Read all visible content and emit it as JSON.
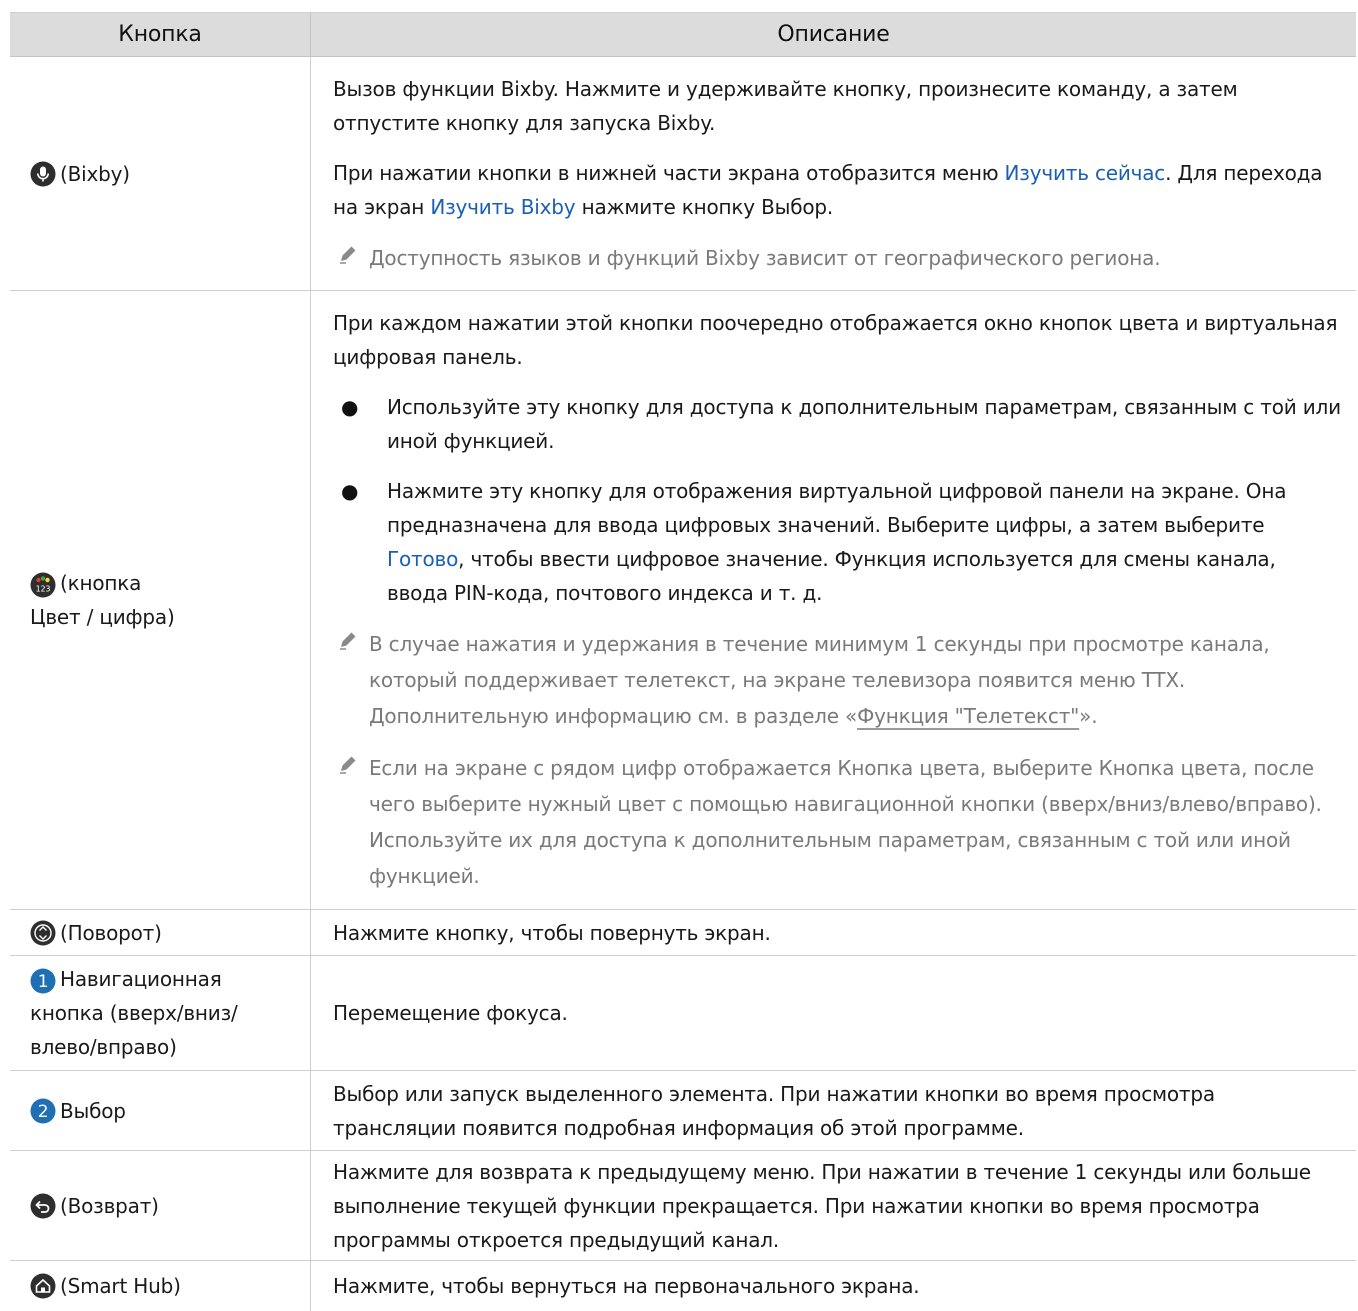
{
  "header": {
    "col_button": "Кнопка",
    "col_description": "Описание"
  },
  "rows": {
    "bixby": {
      "label": "(Bixby)",
      "p1": "Вызов функции Bixby. Нажмите и удерживайте кнопку, произнесите команду, а затем отпустите кнопку для запуска Bixby.",
      "p2_a": "При нажатии кнопки в нижней части экрана отобразится меню ",
      "p2_link1": "Изучить сейчас",
      "p2_b": ". Для перехода на экран ",
      "p2_link2": "Изучить Bixby",
      "p2_c": " нажмите кнопку Выбор.",
      "note": "Доступность языков и функций Bixby зависит от географического региона."
    },
    "color": {
      "label_1": "(кнопка",
      "label_2": "Цвет / цифра)",
      "p1": "При каждом нажатии этой кнопки поочередно отображается окно кнопок цвета и виртуальная цифровая панель.",
      "bullet1": "Используйте эту кнопку для доступа к дополнительным параметрам, связанным с той или иной функцией.",
      "bullet2_a": "Нажмите эту кнопку для отображения виртуальной цифровой панели на экране. Она предназначена для ввода цифровых значений. Выберите цифры, а затем выберите ",
      "bullet2_link": "Готово",
      "bullet2_b": ", чтобы ввести цифровое значение. Функция используется для смены канала, ввода PIN-кода, почтового индекса и т. д.",
      "note1_a": "В случае нажатия и удержания в течение минимум 1 секунды при просмотре канала, который поддерживает телетекст, на экране телевизора появится меню TTX. Дополнительную информацию см. в разделе «",
      "note1_link": "Функция \"Телетекст\"",
      "note1_b": "».",
      "note2": "Если на экране с рядом цифр отображается Кнопка цвета, выберите Кнопка цвета, после чего выберите нужный цвет с помощью навигационной кнопки (вверх/вниз/влево/вправо). Используйте их для доступа к дополнительным параметрам, связанным с той или иной функцией."
    },
    "rotate": {
      "label": "(Поворот)",
      "desc": "Нажмите кнопку, чтобы повернуть экран."
    },
    "nav": {
      "num": "1",
      "label_1": "Навигационная",
      "label_2": "кнопка (вверх/вниз/",
      "label_3": "влево/вправо)",
      "desc": "Перемещение фокуса."
    },
    "select": {
      "num": "2",
      "label": "Выбор",
      "desc": "Выбор или запуск выделенного элемента. При нажатии кнопки во время просмотра трансляции появится подробная информация об этой программе."
    },
    "back": {
      "label": "(Возврат)",
      "desc": "Нажмите для возврата к предыдущему меню. При нажатии в течение 1 секунды или больше выполнение текущей функции прекращается. При нажатии кнопки во время просмотра программы откроется предыдущий канал."
    },
    "home": {
      "label": "(Smart Hub)",
      "desc": "Нажмите, чтобы вернуться на первоначального экрана."
    }
  },
  "icons": {
    "mic": "microphone-icon",
    "color_num": "color-number-icon",
    "color_num_text": "123",
    "rotate": "rotate-icon",
    "back": "back-arrow-icon",
    "home": "home-icon",
    "pencil": "pencil-note-icon"
  },
  "colors": {
    "link": "#1a5fb4",
    "header_bg": "#dcdcdc",
    "note_text": "#7a7a7a",
    "badge_blue": "#1f6fb5",
    "icon_dark": "#2e2e2e"
  }
}
